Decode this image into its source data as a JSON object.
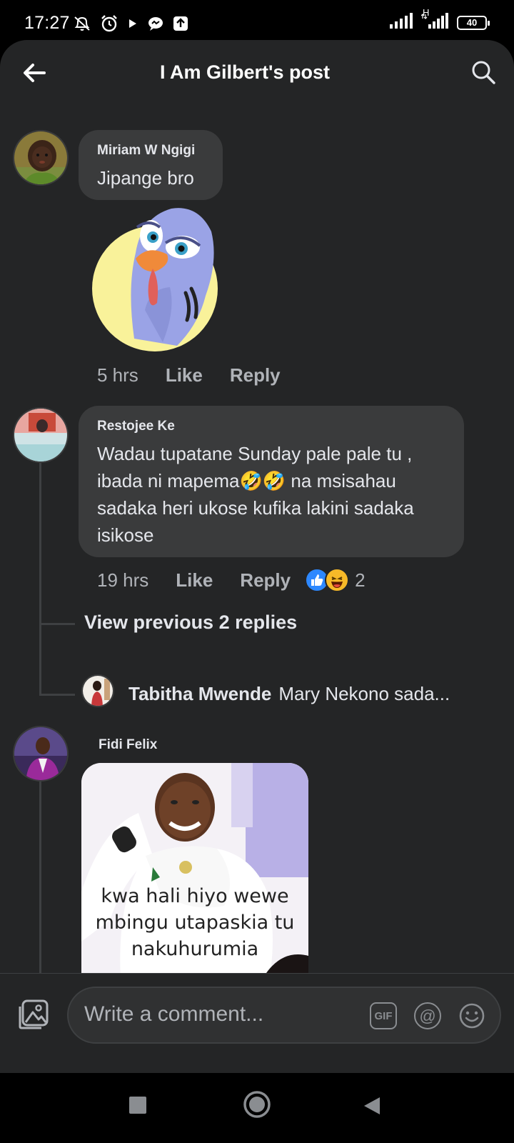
{
  "status_bar": {
    "time": "17:27",
    "battery": "40",
    "network": "H"
  },
  "header": {
    "title": "I Am Gilbert's post"
  },
  "comments": [
    {
      "author": "Miriam W Ngigi",
      "text": "Jipange bro",
      "time": "5 hrs",
      "like_label": "Like",
      "reply_label": "Reply"
    },
    {
      "author": "Restojee Ke",
      "text": "Wadau tupatane Sunday pale pale tu , ibada ni mapema🤣🤣 na msisahau sadaka heri ukose kufika lakini sadaka isikose",
      "time": "19 hrs",
      "like_label": "Like",
      "reply_label": "Reply",
      "reaction_count": "2",
      "view_replies_label": "View previous 2 replies",
      "latest_reply": {
        "author": "Tabitha Mwende",
        "text": "Mary Nekono sada..."
      }
    },
    {
      "author": "Fidi Felix",
      "image_caption": "kwa hali hiyo  wewe mbingu utapaskia tu nakuhurumia"
    }
  ],
  "composer": {
    "placeholder": "Write a comment...",
    "gif_label": "GIF",
    "at_label": "@"
  },
  "colors": {
    "background": "#242526",
    "bubble": "#3a3b3c",
    "text": "#e4e6eb",
    "secondary_text": "#b0b3b8",
    "like_blue": "#2d88ff",
    "haha_yellow": "#f7b928"
  }
}
